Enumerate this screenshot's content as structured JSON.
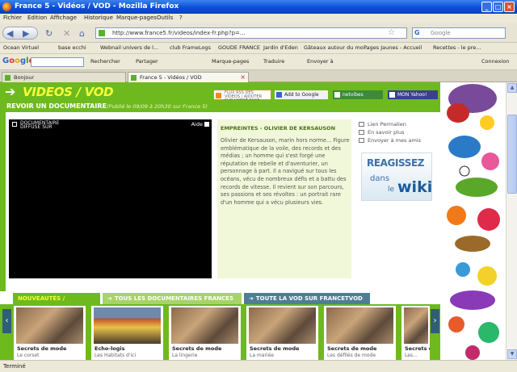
{
  "window": {
    "title": "France 5 - Vidéos / VOD - Mozilla Firefox",
    "min": "_",
    "max": "□",
    "close": "×"
  },
  "menu": [
    "Fichier",
    "Edition",
    "Affichage",
    "Historique",
    "Marque-pages",
    "Outils",
    "?"
  ],
  "nav": {
    "url": "http://www.france5.fr/videos/index-fr.php?p=...",
    "search_placeholder": "Google",
    "back": "◀",
    "forward": "▶",
    "reload": "↻",
    "stop": "✕",
    "home": "⌂"
  },
  "bookmarks": [
    "Ocean Virtuel",
    "base ecchi",
    "Webnail univers de l...",
    "club FrameLogs",
    "GOUDE FRANCE",
    "Jardin d'Eden",
    "Gâteaux autour du mo...",
    "Pages Jaunes - Accueil",
    "Recettes - le pre..."
  ],
  "google_bar": {
    "logo": "Google",
    "items": [
      "Rechercher",
      "Partager",
      "Marque-pages",
      "Traduire",
      "Envoyer à",
      "Connexion"
    ]
  },
  "tabs": [
    {
      "label": "Bonjour"
    },
    {
      "label": "France 5 - Vidéos / VOD"
    }
  ],
  "site": {
    "title": "VIDEOS / VOD",
    "rss": "FLUX RSS DES VIDEOS / AJOUTER SUR VOTRE PAGE",
    "partners": [
      "Add to Google",
      "netvibes",
      "MON Yahoo!"
    ],
    "subhead_bold": "REVOIR UN DOCUMENTAIRE",
    "subhead_small": "(Publié le 09/09 à 20h30 sur France 5)",
    "player": {
      "label": "DOCUMENTAIRE\nDIFFUSE SUR",
      "help": "Aide"
    },
    "desc_title": "EMPREINTES - OLIVIER DE KERSAUSON",
    "desc_body": "Olivier de Kersauson, marin hors norme... Figure emblématique de la voile, des records et des médias ; un homme qui s'est forgé une réputation de rebelle et d'aventurier, un personnage à part. Il a navigué sur tous les océans, vécu de nombreux défis et a battu des records de vitesse. Il revient sur son parcours, ses passions et ses révoltes : un portrait rare d'un homme qui a vécu plusieurs vies.",
    "links": [
      "Lien Permalien",
      "En savoir plus",
      "Envoyer à mes amis"
    ],
    "wiki": {
      "reagissez": "REAGISSEZ",
      "dans": "dans",
      "le": "le",
      "wiki": "wiki"
    },
    "bottom_tabs": [
      "NOUVEAUTÉS / SÉLECTION",
      "TOUS LES DOCUMENTAIRES FRANCE5",
      "TOUTE LA VOD SUR FRANCETVOD"
    ],
    "cards": [
      {
        "t1": "Secrets de mode",
        "t2": "Le corset"
      },
      {
        "t1": "Echo-logis",
        "t2": "Les Habitats d'ici"
      },
      {
        "t1": "Secrets de mode",
        "t2": "La lingerie"
      },
      {
        "t1": "Secrets de mode",
        "t2": "La mariée"
      },
      {
        "t1": "Secrets de mode",
        "t2": "Les défilés de mode"
      },
      {
        "t1": "Secrets de mode",
        "t2": "Les..."
      }
    ],
    "prev": "‹",
    "next": "›"
  },
  "status": "Terminé",
  "colors": {
    "site_green": "#6eba1e",
    "title_yellow": "#f6ff38",
    "vod_tab": "#4f7e94"
  }
}
